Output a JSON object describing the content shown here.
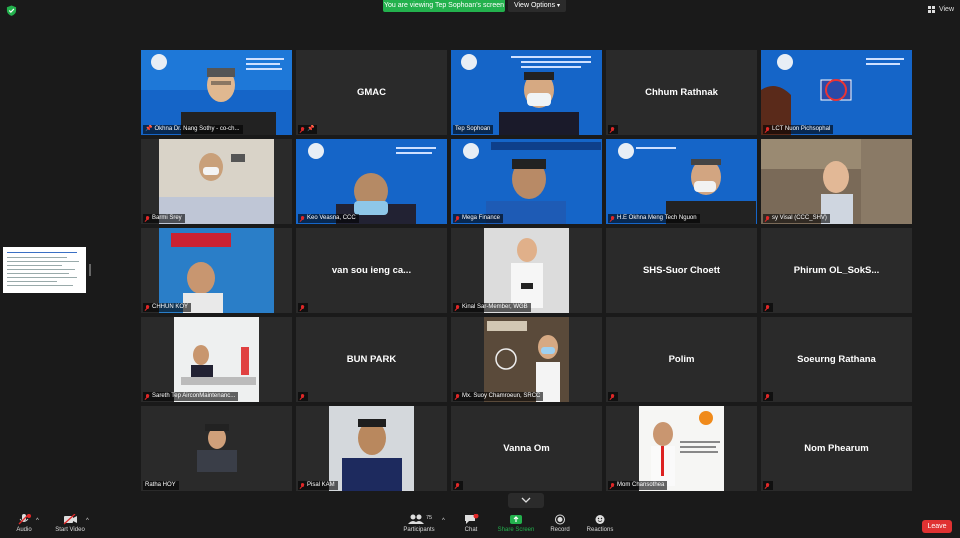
{
  "header": {
    "viewing_banner": "You are viewing Tep Sophoan's screen",
    "view_options": "View Options",
    "view_button": "View"
  },
  "tiles": [
    {
      "label": "Okhna Dr. Nang Sothy - co-ch...",
      "name": "",
      "video": true
    },
    {
      "label": "",
      "name": "GMAC",
      "video": false
    },
    {
      "label": "Tep Sophoan",
      "name": "",
      "video": true
    },
    {
      "label": "",
      "name": "Chhum Rathnak",
      "video": false
    },
    {
      "label": "LCT Nuon Pichsophal",
      "name": "",
      "video": true
    },
    {
      "label": "Barmi Srey",
      "name": "",
      "video": true
    },
    {
      "label": "Keo Veasna, CCC",
      "name": "",
      "video": true
    },
    {
      "label": "Mega Finance",
      "name": "",
      "video": true
    },
    {
      "label": "H.E Okhna Meng Tech Nguon",
      "name": "",
      "video": true
    },
    {
      "label": "sy Visal (CCC_SHV)",
      "name": "",
      "video": true
    },
    {
      "label": "CHHUN KOY",
      "name": "",
      "video": true
    },
    {
      "label": "",
      "name": "van sou ieng ca...",
      "video": false
    },
    {
      "label": "Kinal Sar-Member, WGB",
      "name": "",
      "video": true
    },
    {
      "label": "",
      "name": "SHS-Suor Choett",
      "video": false
    },
    {
      "label": "",
      "name": "Phirum  OL_SokS...",
      "video": false
    },
    {
      "label": "Sareth Tep AirconMaintenanc...",
      "name": "",
      "video": true
    },
    {
      "label": "",
      "name": "BUN PARK",
      "video": false
    },
    {
      "label": "Mx. Suoy Chamroeun, SRCC",
      "name": "",
      "video": true
    },
    {
      "label": "",
      "name": "Polim",
      "video": false
    },
    {
      "label": "",
      "name": "Soeurng Rathana",
      "video": false
    },
    {
      "label": "Ratha HOY",
      "name": "",
      "video": true
    },
    {
      "label": "Pisal KAM",
      "name": "",
      "video": true
    },
    {
      "label": "",
      "name": "Vanna Om",
      "video": false
    },
    {
      "label": "Mom Chansothea",
      "name": "",
      "video": true
    },
    {
      "label": "",
      "name": "Nom Phearum",
      "video": false
    }
  ],
  "toolbar": {
    "audio": "Audio",
    "start_video": "Start Video",
    "participants": "Participants",
    "participants_count": "75",
    "chat": "Chat",
    "share_screen": "Share Screen",
    "record": "Record",
    "reactions": "Reactions",
    "leave": "Leave"
  },
  "colors": {
    "banner_green": "#23b14d",
    "speaker_outline": "#e5de55",
    "leave_red": "#e03232",
    "mute_red": "#e02828"
  }
}
